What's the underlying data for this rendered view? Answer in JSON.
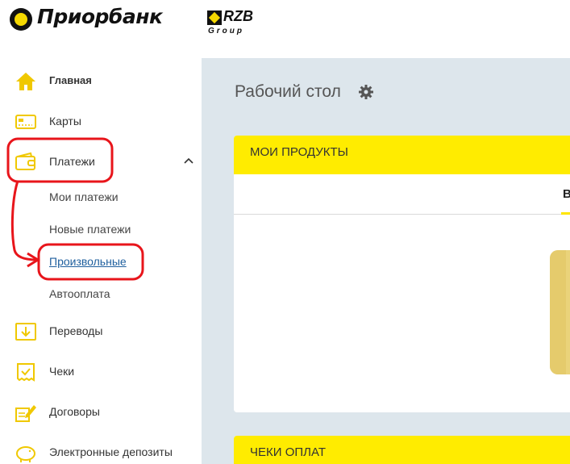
{
  "brand": {
    "bank_name": "Приорбанк",
    "group_mark": "RZB",
    "group_sub": "Group"
  },
  "sidebar": {
    "items": [
      {
        "label": "Главная",
        "icon": "home-icon"
      },
      {
        "label": "Карты",
        "icon": "card-icon"
      },
      {
        "label": "Платежи",
        "icon": "wallet-icon",
        "expanded": true
      },
      {
        "label": "Переводы",
        "icon": "transfer-icon"
      },
      {
        "label": "Чеки",
        "icon": "receipt-icon"
      },
      {
        "label": "Договоры",
        "icon": "contract-icon"
      },
      {
        "label": "Электронные депозиты",
        "icon": "piggy-bank-icon"
      }
    ],
    "payments_sub": [
      {
        "label": "Мои платежи"
      },
      {
        "label": "Новые платежи"
      },
      {
        "label": "Произвольные",
        "active": true
      },
      {
        "label": "Автооплата"
      }
    ]
  },
  "main": {
    "title": "Рабочий стол",
    "products_card": {
      "title": "МОИ ПРОДУКТЫ",
      "tab_label_partial": "В"
    },
    "receipts_card": {
      "title": "ЧЕКИ ОПЛАТ"
    }
  },
  "colors": {
    "accent_yellow": "#ffec00",
    "icon_yellow": "#f0c800",
    "annotation_red": "#e8151b",
    "link_blue": "#1f5f9e"
  }
}
